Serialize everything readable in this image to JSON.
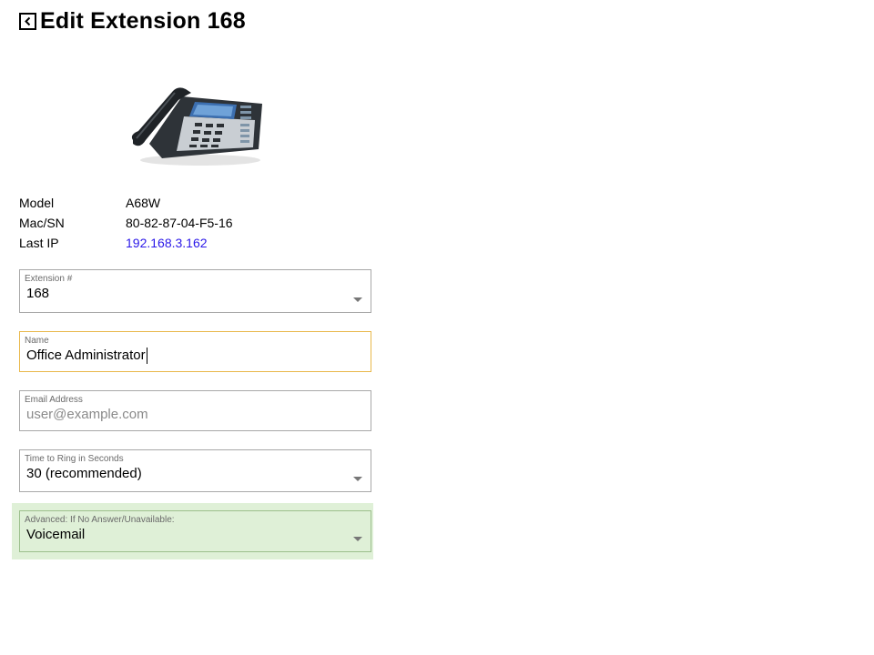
{
  "header": {
    "title": "Edit Extension 168"
  },
  "device": {
    "image_alt": "IP desk phone",
    "rows": [
      {
        "label": "Model",
        "value": "A68W"
      },
      {
        "label": "Mac/SN",
        "value": "80-82-87-04-F5-16"
      },
      {
        "label": "Last IP",
        "value": "192.168.3.162"
      }
    ]
  },
  "form": {
    "extension": {
      "label": "Extension #",
      "value": "168"
    },
    "name": {
      "label": "Name",
      "value": "Office Administrator"
    },
    "email": {
      "label": "Email Address",
      "placeholder": "user@example.com",
      "value": ""
    },
    "ring_time": {
      "label": "Time to Ring in Seconds",
      "value": "30 (recommended)"
    },
    "no_answer": {
      "label": "Advanced: If No Answer/Unavailable:",
      "value": "Voicemail"
    }
  },
  "colors": {
    "link": "#2a17e8",
    "focus_border": "#e9b84a",
    "advanced_bg": "#dff0d7"
  },
  "icons": {
    "back": "chevron-left-icon",
    "dropdown": "caret-down-icon"
  }
}
